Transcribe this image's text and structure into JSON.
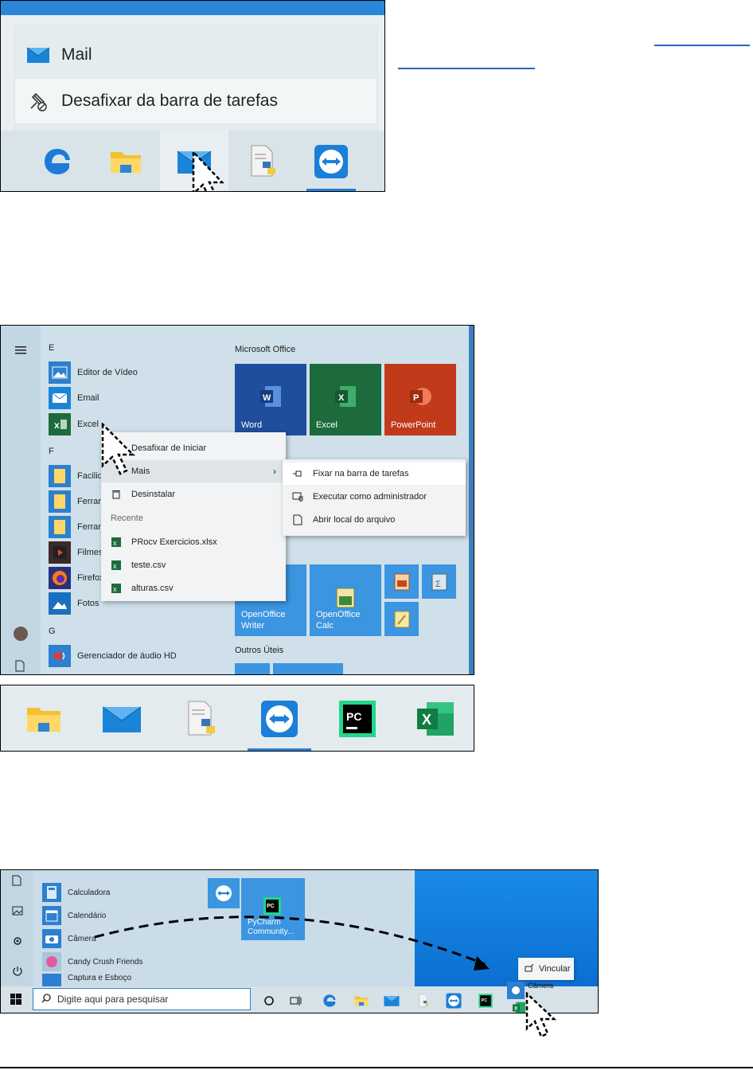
{
  "panel1": {
    "menu": {
      "mail_label": "Mail",
      "unpin_label": "Desafixar da barra de tarefas"
    },
    "taskbar_icons": [
      "edge-icon",
      "file-explorer-icon",
      "mail-icon",
      "python-file-icon",
      "teamviewer-icon"
    ]
  },
  "panel2": {
    "letters": {
      "e": "E",
      "f": "F",
      "g": "G"
    },
    "apps": {
      "video_editor": "Editor de Vídeo",
      "email": "Email",
      "excel": "Excel",
      "facil": "Facilid",
      "ferram1": "Ferram",
      "ferram2": "Ferram",
      "filmes": "Filmes",
      "firefox": "Firefox",
      "fotos": "Fotos",
      "audio": "Gerenciador de áudio HD"
    },
    "sections": {
      "office": "Microsoft Office",
      "others": "Outros Úteis"
    },
    "tiles": {
      "word": "Word",
      "excel": "Excel",
      "powerpoint": "PowerPoint",
      "oo_writer_1": "OpenOffice",
      "oo_writer_2": "Writer",
      "oo_calc_1": "OpenOffice",
      "oo_calc_2": "Calc"
    },
    "context": {
      "unpin_start": "Desafixar de Iniciar",
      "more": "Mais",
      "uninstall": "Desinstalar",
      "recent": "Recente",
      "files": [
        "PRocv Exercicios.xlsx",
        "teste.csv",
        "alturas.csv"
      ]
    },
    "submenu": {
      "pin_taskbar": "Fixar na barra de tarefas",
      "run_admin": "Executar como administrador",
      "open_location": "Abrir local do arquivo"
    }
  },
  "panel3": {
    "taskbar_icons": [
      "file-explorer-icon",
      "mail-icon",
      "python-file-icon",
      "teamviewer-icon",
      "pycharm-icon",
      "excel-icon"
    ]
  },
  "panel4": {
    "apps": {
      "calc": "Calculadora",
      "calendar": "Calendário",
      "camera": "Câmera",
      "candy": "Candy Crush Friends",
      "capture": "Captura e Esboço"
    },
    "tiles": {
      "pycharm_1": "PyCharm",
      "pycharm_2": "Community..."
    },
    "search_placeholder": "Digite aqui para pesquisar",
    "tooltip": "Vincular",
    "drag_label": "Câmera"
  },
  "colors": {
    "accent": "#2b7fd6",
    "word": "#1f4e9c",
    "excel": "#1d6b3c",
    "powerpoint": "#c13b1b",
    "tile_blue": "#3b95e0"
  }
}
